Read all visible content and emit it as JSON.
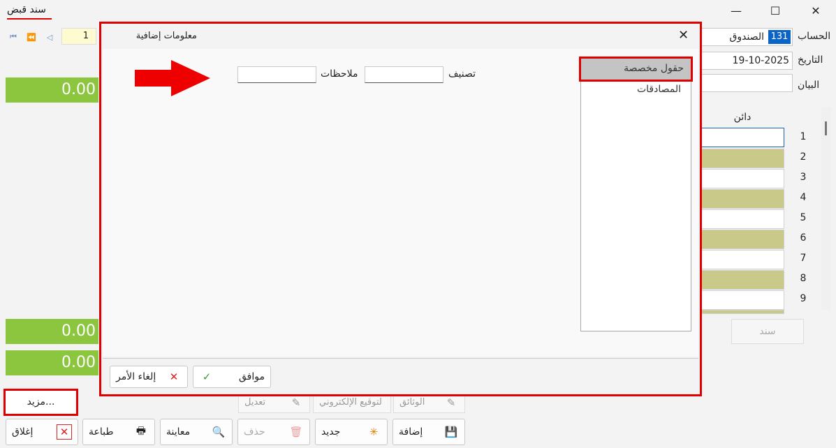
{
  "window": {
    "title": "سند قبض",
    "minimize": "—",
    "maximize": "☐",
    "close": "✕"
  },
  "nav": {
    "first": "⏮",
    "prev_fast": "⏪",
    "prev": "◁",
    "page": "1"
  },
  "form": {
    "account_label": "الحساب",
    "account_code": "131",
    "account_name": "الصندوق",
    "date_label": "التاريخ",
    "date_value": "19-10-2025",
    "statement_label": "البيان",
    "credit_header": "دائن",
    "doc_button": "سند"
  },
  "totals": {
    "top": "0.00",
    "mid": "0.00",
    "bottom": "0.00"
  },
  "rows": [
    "1",
    "2",
    "3",
    "4",
    "5",
    "6",
    "7",
    "8",
    "9"
  ],
  "behind_buttons": {
    "edit": "تعديل",
    "esign": "لتوقيع الإلكتروني",
    "documents": "الوثائق"
  },
  "more_button": "مزيد...",
  "bottom_buttons": {
    "close": "إغلاق",
    "print": "طباعة",
    "preview": "معاينة",
    "delete": "حذف",
    "new": "جديد",
    "add": "إضافة"
  },
  "dialog": {
    "title": "معلومات إضافية",
    "close": "✕",
    "list_items": [
      "حقول مخصصة",
      "المصادقات"
    ],
    "classification_label": "تصنيف",
    "notes_label": "ملاحظات",
    "ok_button": "موافق",
    "cancel_button": "إلغاء الأمر"
  },
  "colors": {
    "accent_red": "#e00000",
    "green": "#8cc63f",
    "olive_row": "#c9c98a",
    "account_blue": "#0a64c8"
  }
}
